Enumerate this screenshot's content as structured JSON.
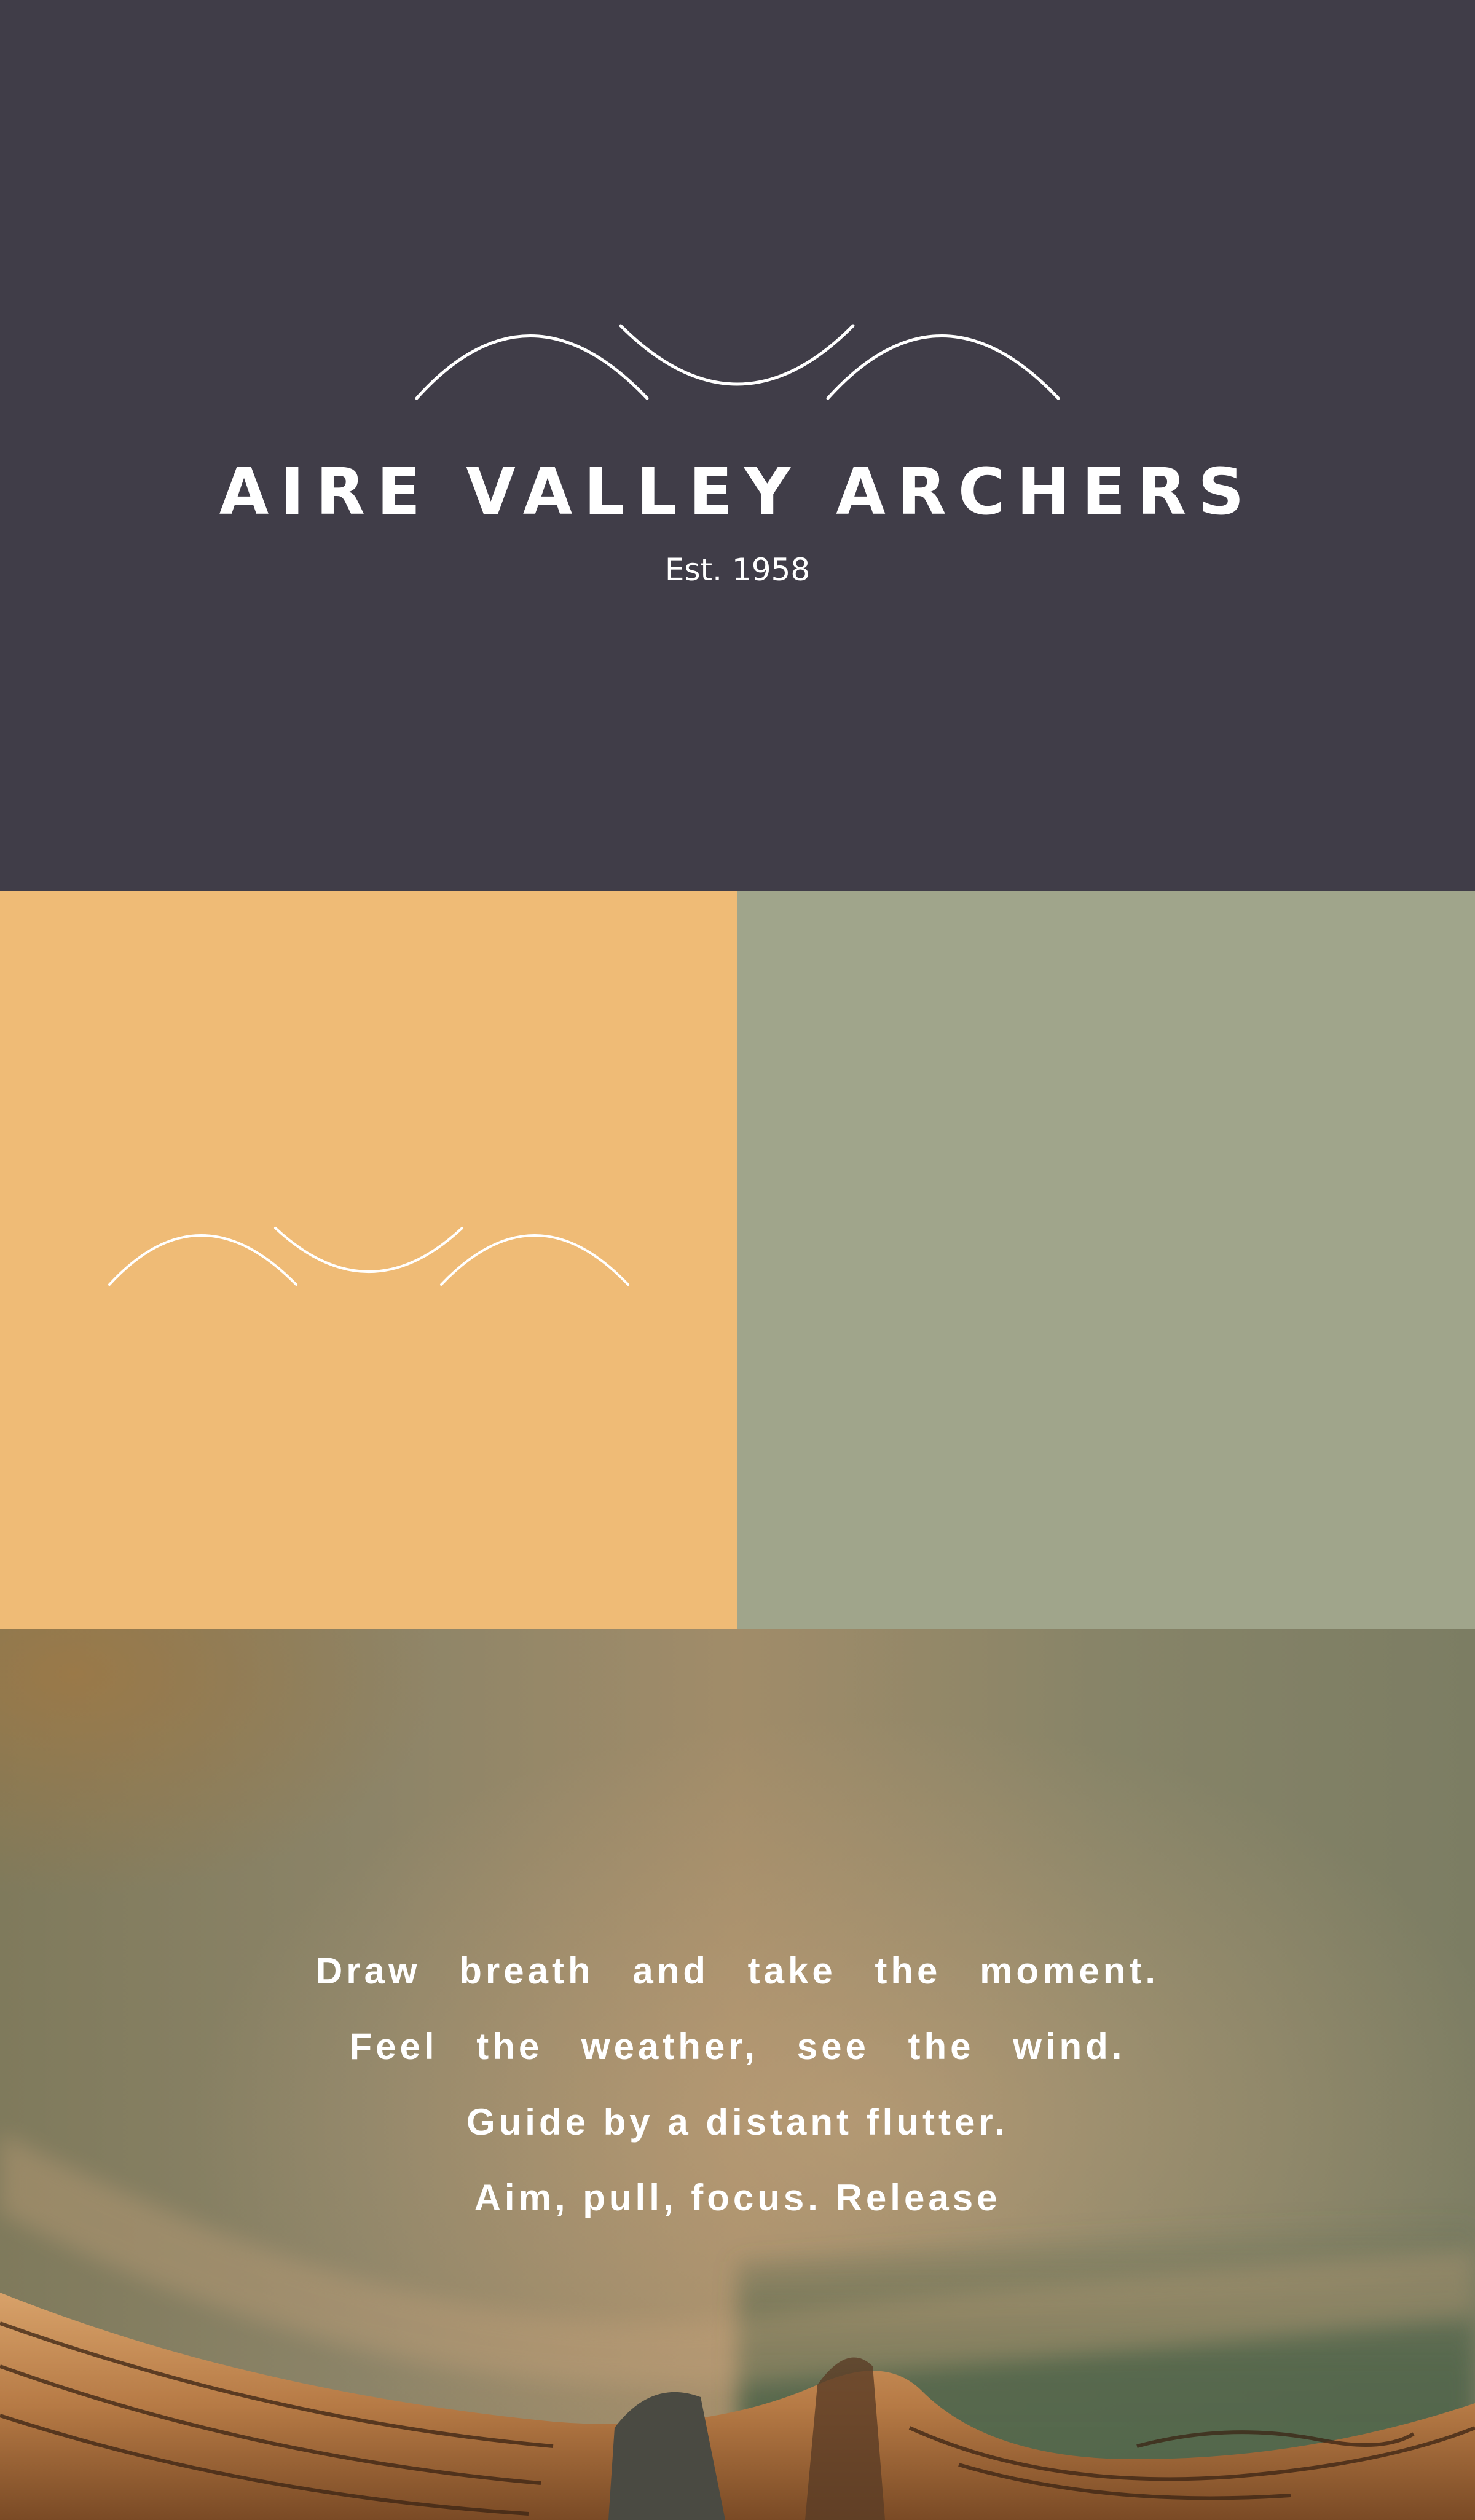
{
  "brand": {
    "name": "AIRE VALLEY ARCHERS",
    "established": "Est. 1958",
    "logo_icon": "bow-arcs-logo"
  },
  "palette": {
    "dark": "#403d48",
    "orange": "#efbb76",
    "sage": "#a0a58b",
    "white": "#ffffff"
  },
  "photo": {
    "subject_icon": "wooden-bow-photo"
  },
  "quote": {
    "lines": [
      "Draw breath and take the moment.",
      "Feel the weather, see the wind.",
      "Guide by a distant flutter.",
      "Aim, pull, focus. Release"
    ]
  }
}
